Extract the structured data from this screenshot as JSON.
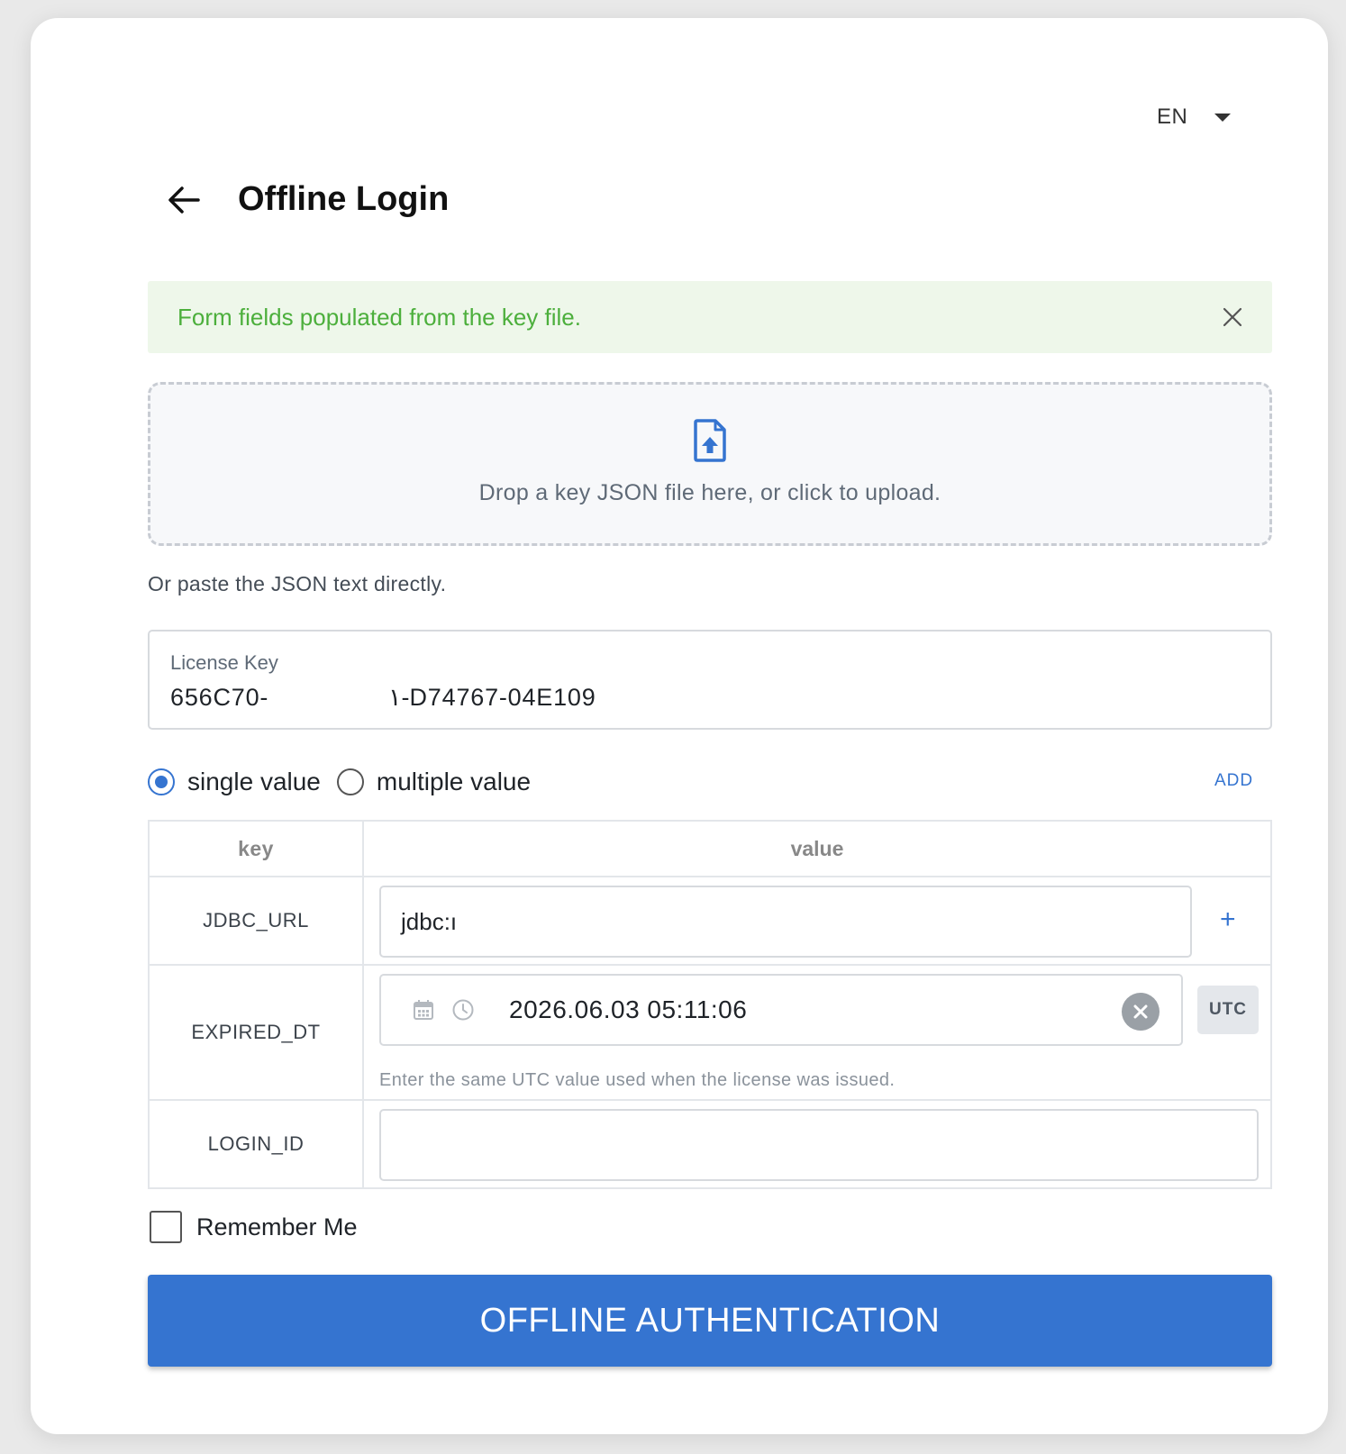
{
  "header": {
    "language": "EN",
    "title": "Offline Login"
  },
  "alert": {
    "message": "Form fields populated from the key file."
  },
  "dropzone": {
    "text": "Drop a key JSON file here, or click to upload."
  },
  "paste_hint": "Or paste the JSON text directly.",
  "license": {
    "label": "License Key",
    "value": "656C70-                ١-D74767-04E109"
  },
  "mode": {
    "options": [
      "single value",
      "multiple value"
    ],
    "selected": "single value",
    "add_label": "ADD"
  },
  "table": {
    "headers": {
      "key": "key",
      "value": "value"
    },
    "rows": [
      {
        "key": "JDBC_URL",
        "value": "jdbc:ı"
      },
      {
        "key": "EXPIRED_DT",
        "value": "2026.06.03 05:11:06",
        "tz": "UTC",
        "hint": "Enter the same UTC value used when the license was issued."
      },
      {
        "key": "LOGIN_ID",
        "value": ""
      }
    ],
    "add_row_symbol": "+"
  },
  "remember": {
    "label": "Remember Me",
    "checked": false
  },
  "submit": {
    "label": "OFFLINE AUTHENTICATION"
  },
  "colors": {
    "primary": "#3574d0",
    "success_text": "#4caf3c",
    "success_bg": "#eef7ea"
  },
  "icons": [
    "chevron-down-icon",
    "arrow-left-icon",
    "close-icon",
    "file-upload-icon",
    "calendar-icon",
    "clock-icon",
    "clear-icon",
    "plus-icon"
  ]
}
